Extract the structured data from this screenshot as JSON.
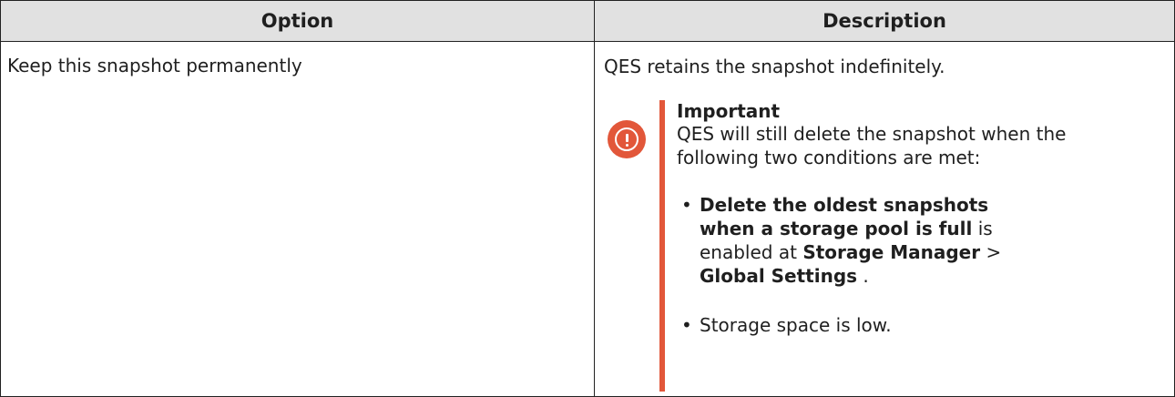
{
  "table": {
    "headers": [
      "Option",
      "Description"
    ],
    "row": {
      "option": "Keep this snapshot permanently",
      "description": "QES retains the snapshot indefinitely."
    }
  },
  "important": {
    "icon": "exclamation-circle-icon",
    "color": "#e2573a",
    "title": "Important",
    "text": "QES will still delete the snapshot when the following two conditions are met:",
    "conditions": [
      {
        "bold1": "Delete the oldest snapshots when a storage pool is full",
        "text1": " is enabled at ",
        "bold2": "Storage Manager",
        "sep": " > ",
        "bold3": "Global Settings",
        "end": " ."
      },
      {
        "text": "Storage space is low."
      }
    ],
    "bullet": "•"
  }
}
